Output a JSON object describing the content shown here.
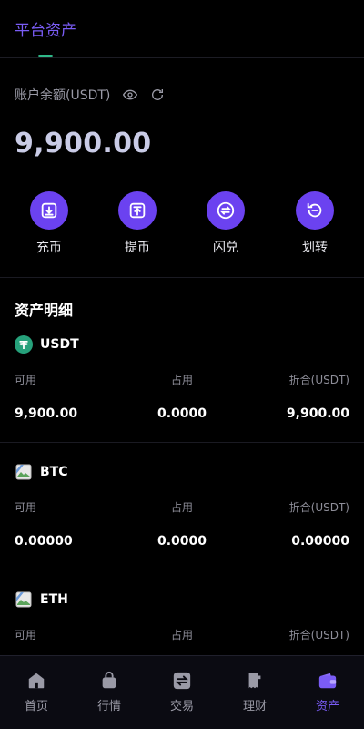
{
  "header": {
    "tab_label": "平台资产"
  },
  "balance": {
    "label": "账户余额(USDT)",
    "value": "9,900.00",
    "eye_icon": "eye-icon",
    "refresh_icon": "refresh-icon"
  },
  "actions": [
    {
      "label": "充币",
      "icon": "deposit-icon"
    },
    {
      "label": "提币",
      "icon": "withdraw-icon"
    },
    {
      "label": "闪兑",
      "icon": "swap-icon"
    },
    {
      "label": "划转",
      "icon": "transfer-icon"
    }
  ],
  "assets_section": {
    "title": "资产明细"
  },
  "columns": {
    "available": "可用",
    "occupied": "占用",
    "converted": "折合(USDT)"
  },
  "assets": [
    {
      "name": "USDT",
      "available": "9,900.00",
      "occupied": "0.0000",
      "converted": "9,900.00",
      "icon": "tether-icon"
    },
    {
      "name": "BTC",
      "available": "0.00000",
      "occupied": "0.0000",
      "converted": "0.00000",
      "icon": "broken-image-icon"
    },
    {
      "name": "ETH",
      "available": "",
      "occupied": "",
      "converted": "",
      "icon": "broken-image-icon"
    }
  ],
  "nav": [
    {
      "label": "首页",
      "icon": "home-icon"
    },
    {
      "label": "行情",
      "icon": "market-icon"
    },
    {
      "label": "交易",
      "icon": "trade-icon"
    },
    {
      "label": "理财",
      "icon": "finance-icon"
    },
    {
      "label": "资产",
      "icon": "wallet-icon",
      "active": true
    }
  ],
  "colors": {
    "accent": "#6b42f0",
    "active_text": "#7a5cf5",
    "tether": "#26a17b",
    "background": "#000000"
  }
}
